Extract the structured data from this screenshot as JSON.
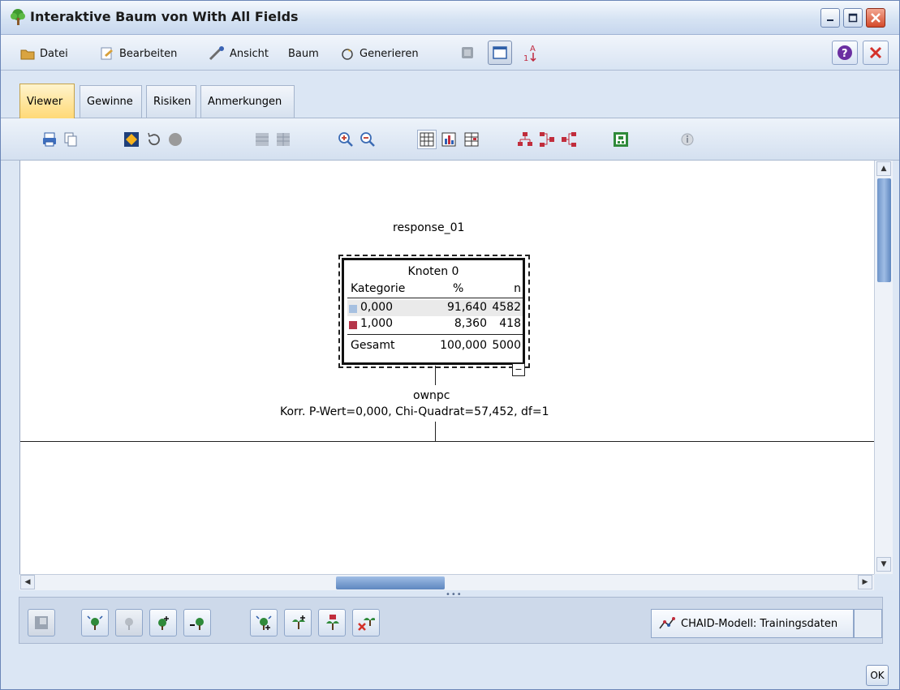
{
  "window": {
    "title": "Interaktive Baum von With All Fields",
    "app_icon": "tree-icon"
  },
  "menubar": {
    "items": [
      {
        "label": "Datei",
        "icon": "folder-icon"
      },
      {
        "label": "Bearbeiten",
        "icon": "edit-icon"
      },
      {
        "label": "Ansicht",
        "icon": "brush-icon"
      },
      {
        "label": "Baum"
      },
      {
        "label": "Generieren",
        "icon": "sparkle-icon"
      }
    ]
  },
  "tabs": [
    "Viewer",
    "Gewinne",
    "Risiken",
    "Anmerkungen"
  ],
  "active_tab": "Viewer",
  "tree": {
    "target": "response_01",
    "node": {
      "title": "Knoten 0",
      "header": {
        "category": "Kategorie",
        "percent": "%",
        "n": "n"
      },
      "rows": [
        {
          "category": "0,000",
          "percent": "91,640",
          "n": "4582",
          "color": "#a6c0e0"
        },
        {
          "category": "1,000",
          "percent": "8,360",
          "n": "418",
          "color": "#b5354a"
        }
      ],
      "total": {
        "label": "Gesamt",
        "percent": "100,000",
        "n": "5000"
      },
      "expander": "−"
    },
    "split_variable": "ownpc",
    "split_stats": "Korr. P-Wert=0,000, Chi-Quadrat=57,452, df=1"
  },
  "bottom": {
    "model_label": "CHAID-Modell: Trainingsdaten",
    "ok": "OK"
  },
  "colors": {
    "active_tab": "#ffd977",
    "window_bg": "#dde7f4",
    "category_0": "#a6c0e0",
    "category_1": "#b5354a"
  }
}
